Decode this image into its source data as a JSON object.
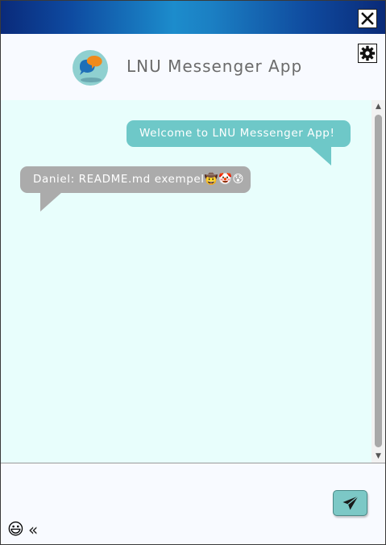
{
  "window": {
    "close_icon": "close-icon"
  },
  "header": {
    "title": "LNU Messenger App",
    "logo_icon": "chat-bubbles-logo",
    "settings_icon": "gear-icon"
  },
  "messages": [
    {
      "text": "Welcome to LNU Messenger App!",
      "own": true
    },
    {
      "text": "Daniel: README.md exempel🤠🤡😰",
      "own": false
    }
  ],
  "scrollbar": {
    "up": "▲",
    "down": "▼"
  },
  "composer": {
    "value": "",
    "send_icon": "paper-plane-icon",
    "emoji": "😃",
    "collapse": "«"
  },
  "colors": {
    "titlebar_accent": "#1c8ccc",
    "own_bubble": "#6ec8c8",
    "other_bubble": "#ababab",
    "chat_bg": "#e8fefc",
    "send_button": "#7cc8c6"
  }
}
